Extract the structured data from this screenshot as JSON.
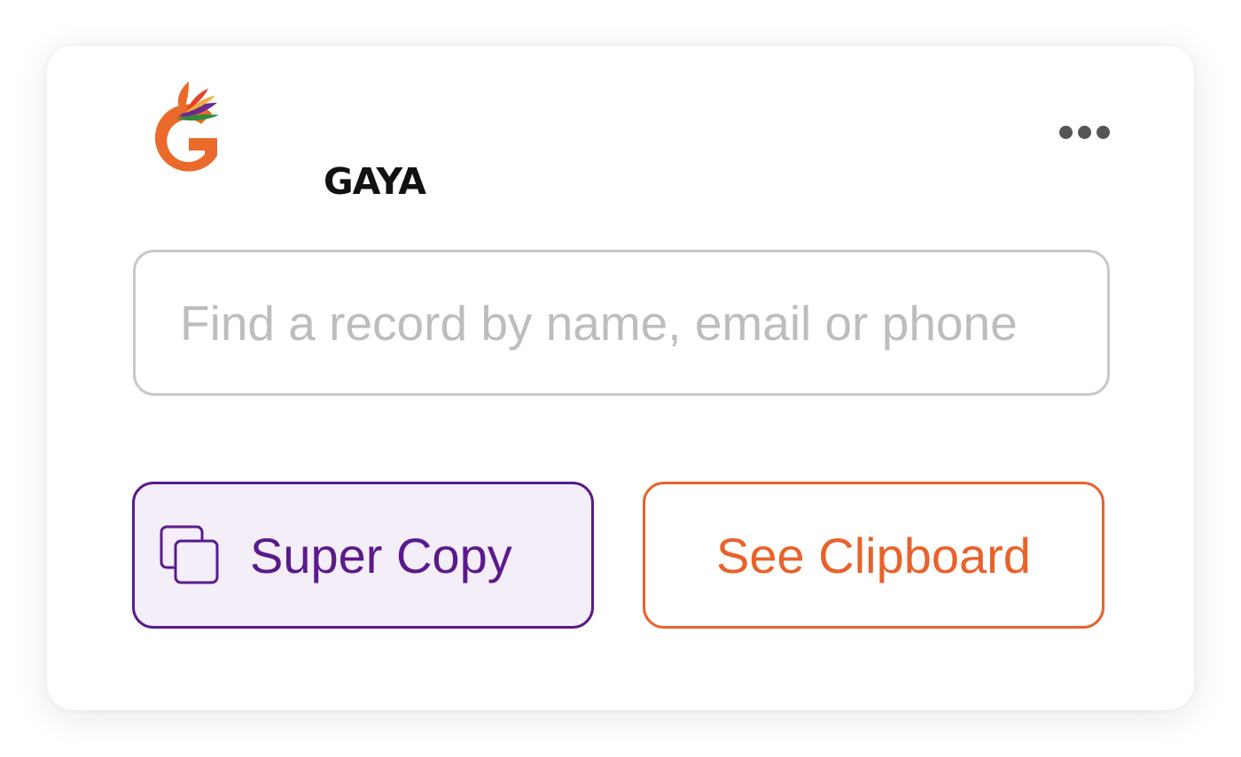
{
  "header": {
    "logo_text": "GAYA",
    "menu_icon": "more-horizontal-icon"
  },
  "search": {
    "placeholder": "Find a record by name, email or phone",
    "value": ""
  },
  "actions": {
    "super_copy_label": "Super Copy",
    "super_copy_icon": "copy-icon",
    "see_clipboard_label": "See Clipboard"
  },
  "colors": {
    "brand_orange": "#e8622c",
    "brand_purple": "#5a1a8b",
    "super_copy_bg": "#f4eef8",
    "input_border": "#c8c8c8",
    "placeholder": "#bdbdbd",
    "menu_dots": "#555555"
  }
}
